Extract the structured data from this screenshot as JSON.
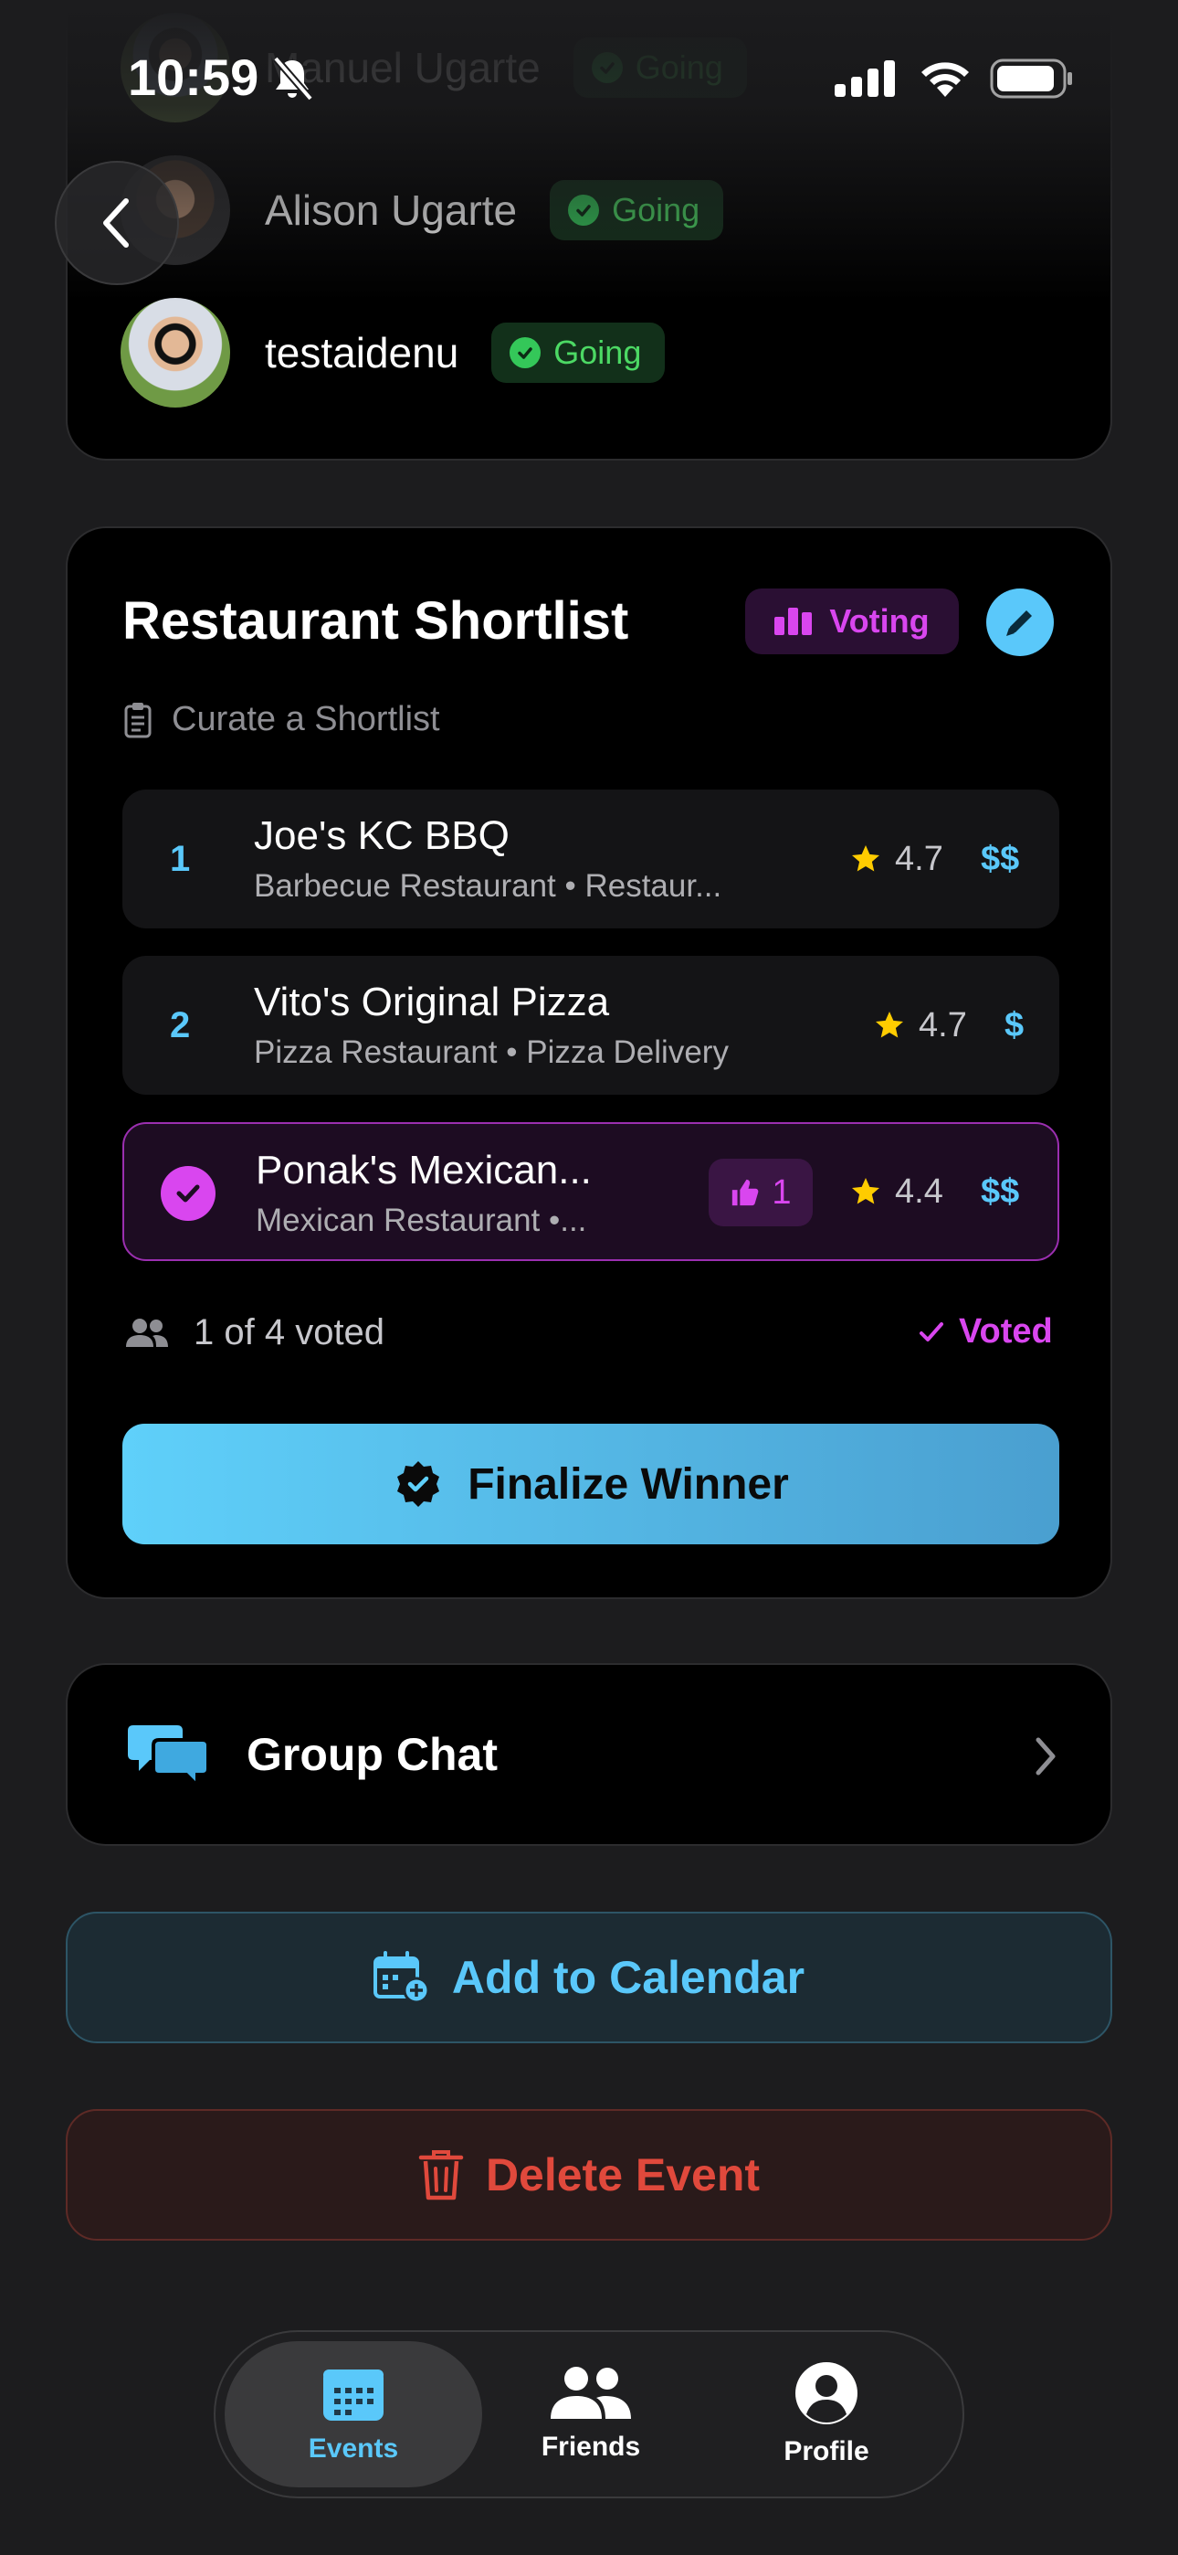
{
  "status_bar": {
    "time": "10:59"
  },
  "attendees": [
    {
      "name": "Manuel Ugarte",
      "status": "Going"
    },
    {
      "name": "Alison Ugarte",
      "status": "Going"
    },
    {
      "name": "testaidenu",
      "status": "Going"
    }
  ],
  "shortlist": {
    "title": "Restaurant Shortlist",
    "badge": "Voting",
    "subtitle": "Curate a Shortlist",
    "restaurants": [
      {
        "rank": "1",
        "name": "Joe's KC BBQ",
        "category": "Barbecue Restaurant • Restaur...",
        "rating": "4.7",
        "price": "$$"
      },
      {
        "rank": "2",
        "name": "Vito's Original Pizza",
        "category": "Pizza Restaurant • Pizza Delivery",
        "rating": "4.7",
        "price": "$"
      },
      {
        "rank": "",
        "name": "Ponak's Mexican...",
        "category": "Mexican Restaurant •...",
        "rating": "4.4",
        "price": "$$",
        "votes": "1",
        "selected": true
      }
    ],
    "voted_count": "1 of 4 voted",
    "voted_status": "Voted",
    "finalize_label": "Finalize Winner"
  },
  "group_chat": {
    "label": "Group Chat"
  },
  "actions": {
    "calendar_label": "Add to Calendar",
    "delete_label": "Delete Event"
  },
  "tab_bar": {
    "tabs": [
      {
        "label": "Events",
        "icon": "calendar-icon",
        "active": true
      },
      {
        "label": "Friends",
        "icon": "people-icon",
        "active": false
      },
      {
        "label": "Profile",
        "icon": "profile-icon",
        "active": false
      }
    ]
  },
  "colors": {
    "accent": "#5ac8fa",
    "voting": "#d946ef",
    "going": "#34c759",
    "danger": "#e0493c"
  }
}
